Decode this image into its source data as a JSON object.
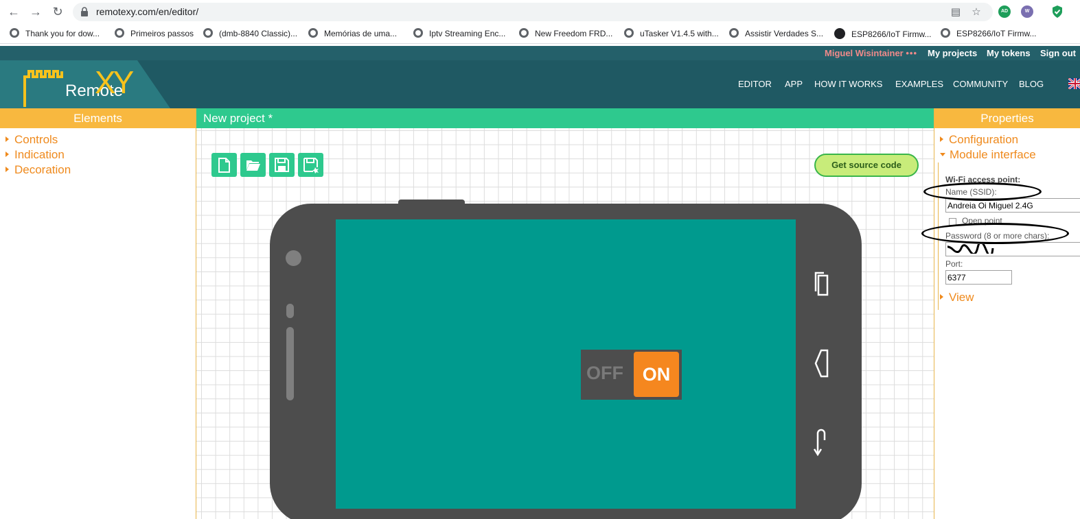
{
  "browser": {
    "url": "remotexy.com/en/editor/",
    "ext1": "AD",
    "ext2": "W",
    "bookmarks": [
      {
        "label": "Thank you for dow...",
        "icon": "globe-icon"
      },
      {
        "label": "Primeiros passos",
        "icon": "globe-icon"
      },
      {
        "label": "(dmb-8840 Classic)...",
        "icon": "globe-icon"
      },
      {
        "label": "Memórias de uma...",
        "icon": "globe-icon"
      },
      {
        "label": "Iptv Streaming Enc...",
        "icon": "globe-icon"
      },
      {
        "label": "New Freedom FRD...",
        "icon": "globe-icon"
      },
      {
        "label": "uTasker V1.4.5 with...",
        "icon": "globe-icon"
      },
      {
        "label": "Assistir Verdades S...",
        "icon": "globe-icon"
      },
      {
        "label": "ESP8266/IoT Firmw...",
        "icon": "github-icon"
      },
      {
        "label": "ESP8266/IoT Firmw...",
        "icon": "globe-icon"
      }
    ]
  },
  "site": {
    "user": "Miguel Wisintainer",
    "user_dots": "•••",
    "my_projects": "My projects",
    "my_tokens": "My tokens",
    "sign_out": "Sign out",
    "logo_text": "Remote",
    "logo_xy": "XY",
    "nav": [
      "EDITOR",
      "APP",
      "HOW IT WORKS",
      "EXAMPLES",
      "COMMUNITY",
      "BLOG"
    ]
  },
  "elements_panel": {
    "title": "Elements",
    "items": [
      "Controls",
      "Indication",
      "Decoration"
    ]
  },
  "editor": {
    "project_title": "New project *",
    "get_source": "Get source code",
    "switch_off": "OFF",
    "switch_on": "ON",
    "switch_state": "on"
  },
  "properties_panel": {
    "title": "Properties",
    "configuration": "Configuration",
    "module_interface": "Module interface",
    "view": "View",
    "wifi_heading": "Wi-Fi access point:",
    "ssid_label": "Name (SSID):",
    "ssid_value": "Andreia Oi Miguel 2.4G",
    "open_point": "Open point",
    "password_label": "Password (8 or more chars):",
    "port_label": "Port:",
    "port_value": "6377"
  },
  "colors": {
    "header": "#1f5963",
    "userbar": "#24606a",
    "panel_head": "#f8b83f",
    "project_head": "#2ec98e",
    "accent_orange": "#ef8a1d",
    "phone_body": "#4d4d4d",
    "phone_screen": "#009a8e",
    "switch_on": "#f5871f"
  }
}
